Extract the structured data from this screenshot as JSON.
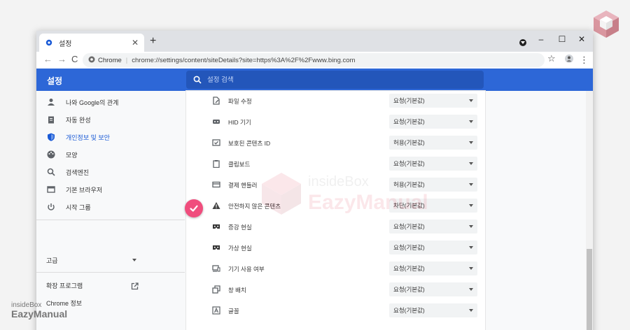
{
  "browser": {
    "tab_title": "설정",
    "tab_close": "✕",
    "new_tab": "+",
    "controls": {
      "minimize": "–",
      "maximize": "☐",
      "close": "✕"
    },
    "nav": {
      "back": "←",
      "forward": "→",
      "reload": "C"
    },
    "omnibox": {
      "site_label": "Chrome",
      "separator": "|",
      "url": "chrome://settings/content/siteDetails?site=https%3A%2F%2Fwww.bing.com"
    },
    "star": "☆",
    "menu": "⋮"
  },
  "settings": {
    "title": "설정",
    "search_placeholder": "설정 검색"
  },
  "sidebar": {
    "items": [
      {
        "icon": "person-icon",
        "label": "나와 Google의 관계"
      },
      {
        "icon": "clipboard-icon",
        "label": "자동 완성"
      },
      {
        "icon": "shield-icon",
        "label": "개인정보 및 보안",
        "active": true
      },
      {
        "icon": "palette-icon",
        "label": "모양"
      },
      {
        "icon": "search-icon",
        "label": "검색엔진"
      },
      {
        "icon": "browser-window-icon",
        "label": "기본 브라우저"
      },
      {
        "icon": "power-icon",
        "label": "시작 그룹"
      }
    ],
    "advanced_label": "고급",
    "extensions_label": "확장 프로그램",
    "about_label": "Chrome 정보"
  },
  "permissions": [
    {
      "icon": "file-edit-icon",
      "label": "파일 수정",
      "value": "요청(기본값)"
    },
    {
      "icon": "hid-device-icon",
      "label": "HID 기기",
      "value": "요청(기본값)"
    },
    {
      "icon": "protected-content-icon",
      "label": "보호된 콘텐츠 ID",
      "value": "허용(기본값)"
    },
    {
      "icon": "clipboard-icon",
      "label": "클립보드",
      "value": "요청(기본값)"
    },
    {
      "icon": "payment-handler-icon",
      "label": "결제 핸들러",
      "value": "허용(기본값)"
    },
    {
      "icon": "warning-icon",
      "label": "안전하지 않은 콘텐츠",
      "value": "차단(기본값)"
    },
    {
      "icon": "ar-icon",
      "label": "증강 현실",
      "value": "요청(기본값)"
    },
    {
      "icon": "vr-icon",
      "label": "가상 현실",
      "value": "요청(기본값)"
    },
    {
      "icon": "device-use-icon",
      "label": "기기 사용 여부",
      "value": "요청(기본값)"
    },
    {
      "icon": "window-placement-icon",
      "label": "창 배치",
      "value": "요청(기본값)"
    },
    {
      "icon": "font-icon",
      "label": "글꼴",
      "value": "요청(기본값)"
    }
  ],
  "watermark": {
    "line1": "insideBox",
    "line2": "EazyManual"
  },
  "brand": {
    "line1": "insideBox",
    "line2": "EazyManual"
  },
  "colors": {
    "header": "#2d67d7",
    "accent": "#1a5ad6",
    "check_badge": "#f04d7d"
  }
}
